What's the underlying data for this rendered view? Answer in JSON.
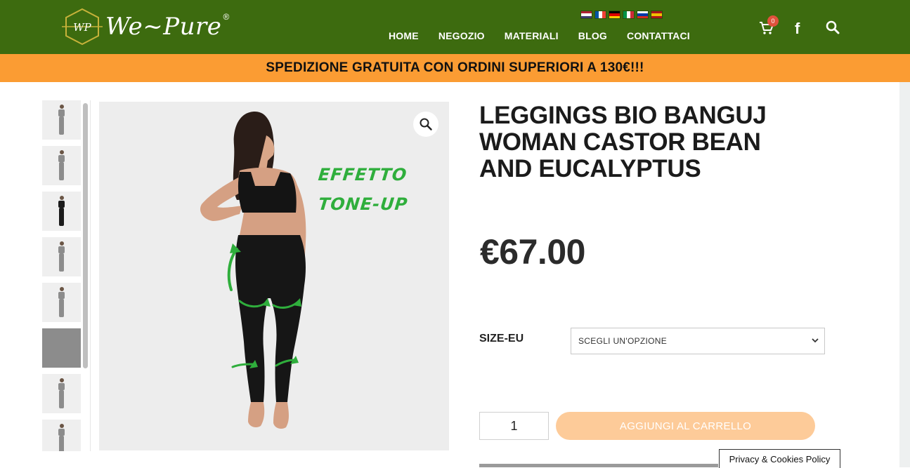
{
  "header": {
    "logo_monogram": "WP",
    "logo_text": "We~Pure",
    "logo_reg": "®",
    "languages": [
      {
        "name": "english-flag",
        "colors": [
          "#b22234",
          "#ffffff",
          "#3c3b6e"
        ]
      },
      {
        "name": "french-flag",
        "colors": [
          "#0055a4",
          "#ffffff",
          "#ef4135"
        ]
      },
      {
        "name": "german-flag",
        "colors": [
          "#000000",
          "#dd0000",
          "#ffce00"
        ]
      },
      {
        "name": "italian-flag",
        "colors": [
          "#009246",
          "#ffffff",
          "#ce2b37"
        ]
      },
      {
        "name": "russian-flag",
        "colors": [
          "#ffffff",
          "#0039a6",
          "#d52b1e"
        ]
      },
      {
        "name": "spanish-flag",
        "colors": [
          "#aa151b",
          "#f1bf00",
          "#aa151b"
        ]
      }
    ],
    "nav": [
      "HOME",
      "NEGOZIO",
      "MATERIALI",
      "BLOG",
      "CONTATTACI"
    ],
    "cart_count": "0",
    "facebook_glyph": "f"
  },
  "promo": {
    "text": "SPEDIZIONE GRATUITA CON ORDINI SUPERIORI A 130€!!!"
  },
  "gallery": {
    "thumbnails": [
      "grey",
      "grey",
      "black",
      "grey",
      "grey",
      "closeup",
      "grey",
      "grey"
    ],
    "overlay_line1": "EFFETTO",
    "overlay_line2": "TONE-UP"
  },
  "product": {
    "title": "LEGGINGS BIO BANGUJ WOMAN CASTOR BEAN AND EUCALYPTUS",
    "price": "€67.00",
    "size_label": "SIZE-EU",
    "size_placeholder": "SCEGLI UN'OPZIONE",
    "quantity": "1",
    "add_to_cart": "AGGIUNGI AL CARRELLO"
  },
  "footer": {
    "privacy": "Privacy & Cookies Policy"
  },
  "colors": {
    "header_bg": "#3d6b0f",
    "promo_bg": "#fb9c33",
    "button_bg": "#fdcb99",
    "badge": "#e0523c",
    "overlay_green": "#2fae3c"
  }
}
